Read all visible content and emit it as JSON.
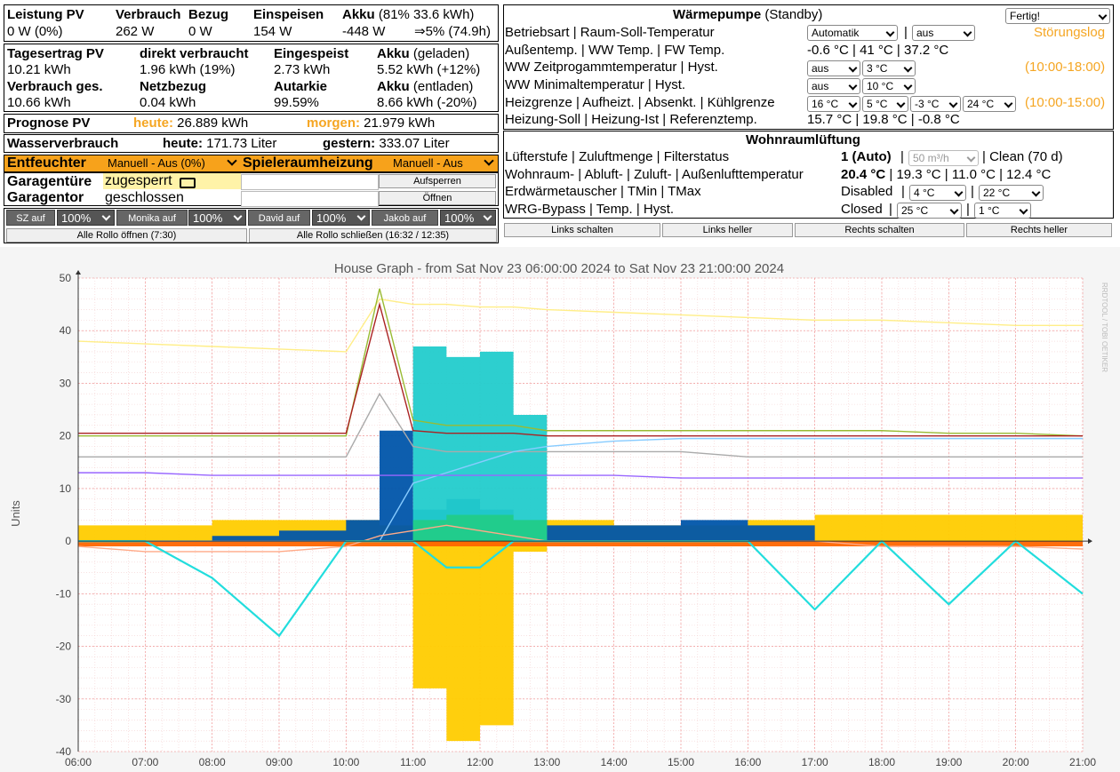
{
  "power": {
    "h_pv": "Leistung PV",
    "h_verbrauch": "Verbrauch",
    "h_bezug": "Bezug",
    "h_einspeisen": "Einspeisen",
    "h_akku": "Akku",
    "h_akku_info": "(81% 33.6 kWh)",
    "v_pv": "0 W (0%)",
    "v_verbrauch": "262 W",
    "v_bezug": "0 W",
    "v_einspeisen": "154 W",
    "v_akku": "-448 W",
    "v_akku_pct": "⇒5% (74.9h)"
  },
  "daily": {
    "h_ertrag": "Tagesertrag PV",
    "h_direkt": "direkt verbraucht",
    "h_eingespeist": "Eingespeist",
    "h_akku1": "Akku",
    "h_akku1_note": "(geladen)",
    "v_ertrag": "10.21 kWh",
    "v_direkt": "1.96 kWh (19%)",
    "v_eingespeist": "2.73 kWh",
    "v_akku1": "5.52 kWh (+12%)",
    "h_verbrauch_ges": "Verbrauch ges.",
    "h_netz": "Netzbezug",
    "h_autarkie": "Autarkie",
    "h_akku2": "Akku",
    "h_akku2_note": "(entladen)",
    "v_verbrauch_ges": "10.66 kWh",
    "v_netz": "0.04 kWh",
    "v_autarkie": "99.59%",
    "v_akku2": "8.66 kWh (-20%)"
  },
  "prognose": {
    "label": "Prognose PV",
    "heute_label": "heute:",
    "heute_val": "26.889 kWh",
    "morgen_label": "morgen:",
    "morgen_val": "21.979 kWh"
  },
  "wasser": {
    "label": "Wasserverbrauch",
    "heute_label": "heute:",
    "heute_val": "171.73 Liter",
    "gestern_label": "gestern:",
    "gestern_val": "333.07 Liter"
  },
  "entfeuchter": {
    "label": "Entfeuchter",
    "select": "Manuell - Aus (0%)",
    "label2": "Spieleraumheizung",
    "select2": "Manuell - Aus"
  },
  "garagentuer": {
    "label": "Garagentüre",
    "status": "zugesperrt",
    "button": "Aufsperren"
  },
  "garagentor": {
    "label": "Garagentor",
    "status": "geschlossen",
    "button": "Öffnen"
  },
  "rollos": {
    "items": [
      {
        "btn": "SZ auf",
        "pct": "100%"
      },
      {
        "btn": "Monika auf",
        "pct": "100%"
      },
      {
        "btn": "David auf",
        "pct": "100%"
      },
      {
        "btn": "Jakob auf",
        "pct": "100%"
      }
    ],
    "open_all": "Alle Rollo öffnen (7:30)",
    "close_all": "Alle Rollo schließen (16:32 / 12:35)"
  },
  "waermepumpe": {
    "title": "Wärmepumpe",
    "status": "(Standby)",
    "top_select": "Fertig!",
    "stoerungslog": "Störungslog",
    "rows": {
      "r1_label": "Betriebsart | Raum-Soll-Temperatur",
      "r1_sel1": "Automatik",
      "r1_sel2": "aus",
      "r2_label": "Außentemp. | WW Temp. | FW Temp.",
      "r2_val": "-0.6 °C | 41 °C | 37.2 °C",
      "r3_label": "WW Zeitprogammtemperatur | Hyst.",
      "r3_sel1": "aus",
      "r3_sel2": "3 °C",
      "r3_time": "(10:00-18:00)",
      "r4_label": "WW Minimaltemperatur | Hyst.",
      "r4_sel1": "aus",
      "r4_sel2": "10 °C",
      "r5_label": "Heizgrenze | Aufheizt. | Absenkt. | Kühlgrenze",
      "r5_sel1": "16 °C",
      "r5_sel2": "5 °C",
      "r5_sel3": "-3 °C",
      "r5_sel4": "24 °C",
      "r5_time": "(10:00-15:00)",
      "r6_label": "Heizung-Soll | Heizung-Ist | Referenztemp.",
      "r6_val": "15.7 °C | 19.8 °C | -0.8 °C"
    }
  },
  "lueftung": {
    "title": "Wohnraumlüftung",
    "r1_label": "Lüfterstufe | Zuluftmenge | Filterstatus",
    "r1_val": "1 (Auto)",
    "r1_sel": "50 m³/h",
    "r1_val2": "| Clean (70 d)",
    "r2_label": "Wohnraum- | Abluft- | Zuluft- | Außenlufttemperatur",
    "r2_val_bold": "20.4 °C",
    "r2_val": "| 19.3 °C | 11.0 °C | 12.4 °C",
    "r3_label": "Erdwärmetauscher | TMin | TMax",
    "r3_val": "Disabled",
    "r3_sel1": "4 °C",
    "r3_sel2": "22 °C",
    "r4_label": "WRG-Bypass | Temp. | Hyst.",
    "r4_val": "Closed",
    "r4_sel1": "25 °C",
    "r4_sel2": "1 °C"
  },
  "jalousie_buttons": [
    "Links schalten",
    "Links heller",
    "Rechts schalten",
    "Rechts heller"
  ],
  "chart_data": {
    "type": "area",
    "title": "House Graph - from Sat Nov 23 06:00:00 2024 to Sat Nov 23 21:00:00 2024",
    "ylabel": "Units",
    "watermark": "RRDTOOL / TOBI OETIKER",
    "ylim": [
      -40,
      50
    ],
    "yticks": [
      -40,
      -30,
      -20,
      -10,
      0,
      10,
      20,
      30,
      40,
      50
    ],
    "xticks": [
      "06:00",
      "07:00",
      "08:00",
      "09:00",
      "10:00",
      "11:00",
      "12:00",
      "13:00",
      "14:00",
      "15:00",
      "16:00",
      "17:00",
      "18:00",
      "19:00",
      "20:00",
      "21:00"
    ],
    "x": [
      6,
      7,
      8,
      9,
      10,
      10.5,
      11,
      11.5,
      12,
      12.5,
      13,
      14,
      15,
      16,
      17,
      18,
      19,
      20,
      21
    ],
    "series": [
      {
        "color": "#ffcc00",
        "values": [
          3,
          3,
          4,
          4,
          4,
          3,
          -28,
          -38,
          -35,
          -2,
          4,
          3,
          3,
          4,
          5,
          5,
          5,
          5,
          5
        ]
      },
      {
        "color": "#0055aa",
        "values": [
          0,
          0,
          1,
          2,
          4,
          21,
          6,
          8,
          6,
          4,
          3,
          3,
          4,
          3,
          0,
          0,
          0,
          0,
          0
        ]
      },
      {
        "color": "#22cccc",
        "values": [
          0,
          0,
          0,
          0,
          0,
          0,
          37,
          35,
          36,
          24,
          0,
          0,
          0,
          0,
          0,
          0,
          0,
          0,
          0
        ]
      },
      {
        "color": "#22cc88",
        "values": [
          0,
          0,
          0,
          0,
          0,
          0,
          4,
          5,
          5,
          4,
          0,
          0,
          0,
          0,
          0,
          0,
          0,
          0,
          0
        ]
      },
      {
        "color": "#ff6600",
        "values": [
          -1,
          -1,
          -1,
          -1,
          -1,
          -1,
          -1,
          -1,
          -1,
          -1,
          -1,
          -1,
          -1,
          -1,
          -1,
          -1,
          -1,
          -1,
          -1.5
        ]
      },
      {
        "color": "#ffee88",
        "values": [
          38,
          37.5,
          37,
          36.5,
          36,
          46,
          45,
          45,
          44.5,
          44.5,
          44,
          43.5,
          43,
          42.5,
          42,
          42,
          41.5,
          41,
          41
        ]
      },
      {
        "color": "#99bb33",
        "values": [
          20,
          20,
          20,
          20,
          20,
          48,
          23,
          22,
          22,
          22,
          21,
          21,
          21,
          21,
          21,
          21,
          20.5,
          20.5,
          20
        ]
      },
      {
        "color": "#aa2222",
        "values": [
          20.5,
          20.5,
          20.5,
          20.5,
          20.5,
          45,
          21,
          20.5,
          20.5,
          20.5,
          20,
          20,
          20,
          20,
          20,
          20,
          20,
          20,
          20
        ]
      },
      {
        "color": "#aaaaaa",
        "values": [
          16,
          16,
          16,
          16,
          16,
          28,
          18,
          17,
          17,
          17,
          17,
          17,
          17,
          16,
          16,
          16,
          16,
          16,
          16
        ]
      },
      {
        "color": "#88ccff",
        "values": [
          0,
          0,
          0,
          0,
          0,
          0,
          11,
          13,
          15,
          17,
          18,
          19,
          19.5,
          19.5,
          19.5,
          19.5,
          19.5,
          19.5,
          19.5
        ]
      },
      {
        "color": "#9966ff",
        "values": [
          13,
          13,
          12.5,
          12.5,
          12.5,
          12.5,
          12.5,
          12.5,
          12.5,
          12.5,
          12.5,
          12.5,
          12,
          12,
          12,
          12,
          12,
          12,
          12
        ]
      },
      {
        "color": "#ffaa88",
        "values": [
          -1,
          -2,
          -2,
          -2,
          -1,
          1,
          2,
          3,
          2,
          1,
          0,
          0,
          0,
          0,
          0,
          -1,
          -1,
          -1,
          -1.5
        ]
      },
      {
        "color": "#22dddd",
        "values": [
          0,
          0,
          -7,
          -18,
          0,
          0,
          0,
          -5,
          -5,
          0,
          0,
          0,
          0,
          0,
          -13,
          0,
          -12,
          0,
          -10
        ]
      }
    ]
  }
}
